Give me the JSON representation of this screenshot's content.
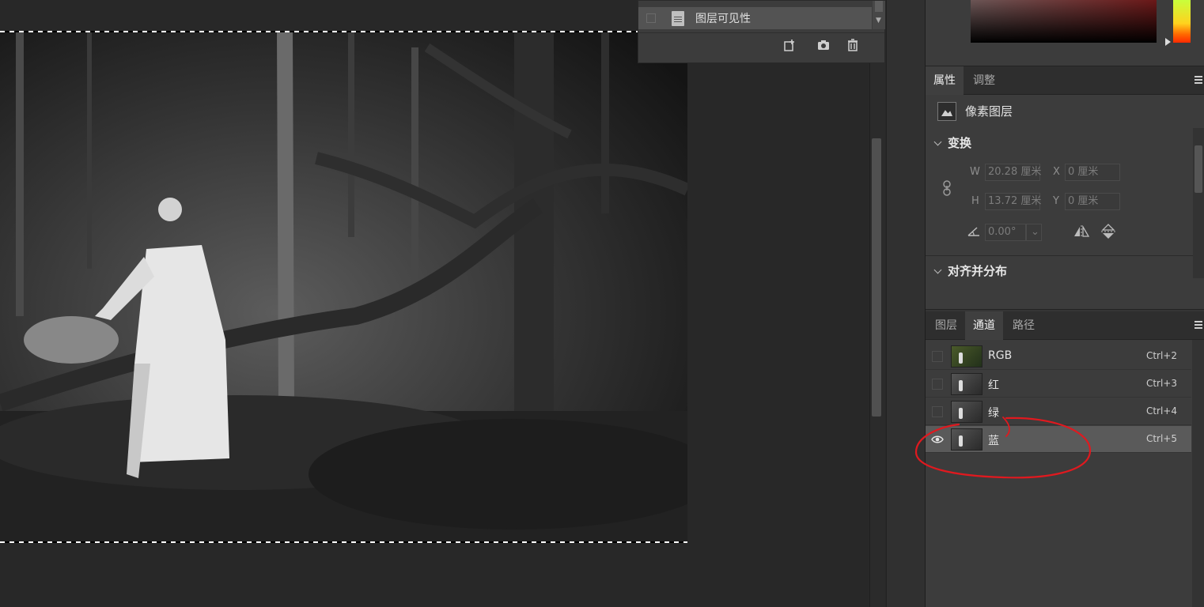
{
  "history": {
    "item_label": "图层可见性"
  },
  "properties": {
    "tabs": [
      "属性",
      "调整"
    ],
    "layer_type": "像素图层",
    "transform_title": "变换",
    "w_label": "W",
    "w_value": "20.28 厘米",
    "h_label": "H",
    "h_value": "13.72 厘米",
    "x_label": "X",
    "x_value": "0 厘米",
    "y_label": "Y",
    "y_value": "0 厘米",
    "angle_value": "0.00°",
    "align_title": "对齐并分布"
  },
  "channels_panel": {
    "tabs": [
      "图层",
      "通道",
      "路径"
    ],
    "active_tab": "通道",
    "channels": [
      {
        "name": "RGB",
        "shortcut": "Ctrl+2",
        "visible": false
      },
      {
        "name": "红",
        "shortcut": "Ctrl+3",
        "visible": false
      },
      {
        "name": "绿",
        "shortcut": "Ctrl+4",
        "visible": false
      },
      {
        "name": "蓝",
        "shortcut": "Ctrl+5",
        "visible": true
      }
    ]
  },
  "colors": {
    "annotation": "#e0191f",
    "selected_row": "#5a5a5a"
  },
  "icons": [
    "new-snapshot-icon",
    "camera-icon",
    "trash-icon",
    "link-icon",
    "angle-icon",
    "flip-horizontal-icon",
    "flip-vertical-icon",
    "eye-icon",
    "panel-menu-icon"
  ]
}
